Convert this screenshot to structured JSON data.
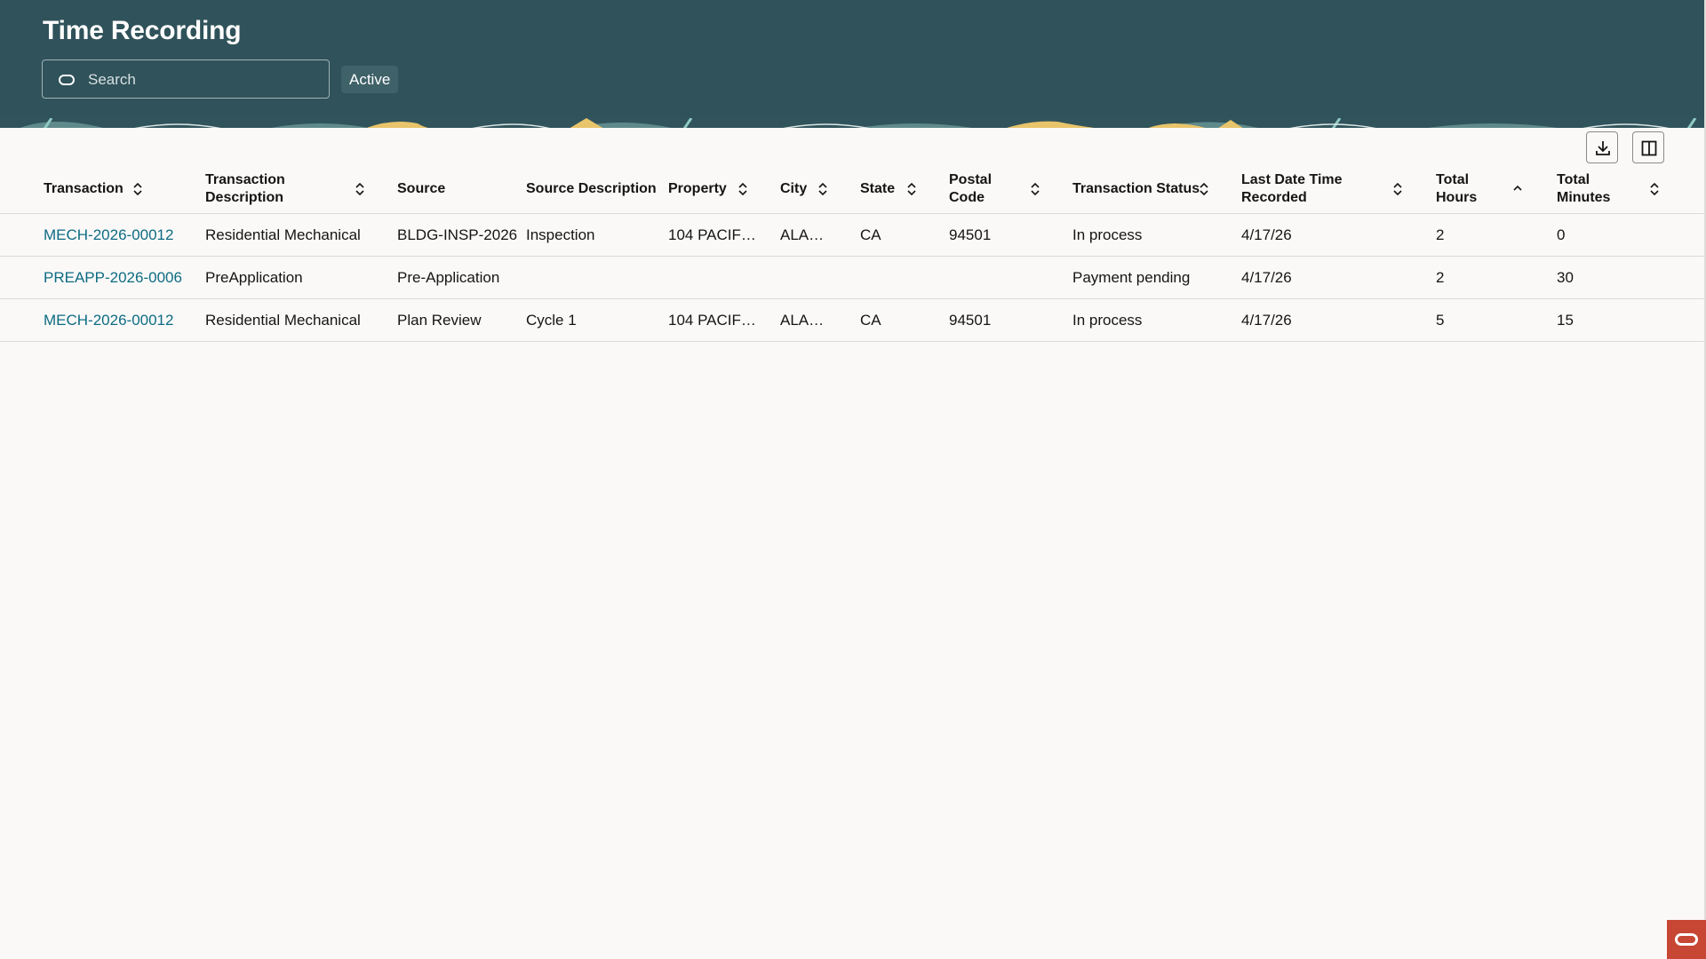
{
  "app": {
    "title": "Time Recording"
  },
  "search": {
    "placeholder": "Search"
  },
  "filter_chip": {
    "label": "Active"
  },
  "toolbar": {
    "buttons": [
      {
        "icon": "download-icon"
      },
      {
        "icon": "columns-icon"
      }
    ]
  },
  "table": {
    "columns": [
      {
        "label": "Transaction",
        "sort": "both"
      },
      {
        "label": "Transaction Description",
        "sort": "both"
      },
      {
        "label": "Source",
        "sort": "none"
      },
      {
        "label": "Source Description",
        "sort": "none"
      },
      {
        "label": "Property",
        "sort": "both"
      },
      {
        "label": "City",
        "sort": "both"
      },
      {
        "label": "State",
        "sort": "both"
      },
      {
        "label": "Postal Code",
        "sort": "both"
      },
      {
        "label": "Transaction Status",
        "sort": "both"
      },
      {
        "label": "Last Date Time Recorded",
        "sort": "both"
      },
      {
        "label": "Total Hours",
        "sort": "ascending"
      },
      {
        "label": "Total Minutes",
        "sort": "both"
      }
    ],
    "rows": [
      [
        "MECH-2026-00012",
        "Residential Mechanical",
        "BLDG-INSP-2026",
        "Inspection",
        "104 PACIF…",
        "ALA…",
        "CA",
        "94501",
        "In process",
        "4/17/26",
        "2",
        "0"
      ],
      [
        "PREAPP-2026-0006",
        "PreApplication",
        "Pre-Application",
        "",
        "",
        "",
        "",
        "",
        "Payment pending",
        "4/17/26",
        "2",
        "30"
      ],
      [
        "MECH-2026-00012",
        "Residential Mechanical",
        "Plan Review",
        "Cycle 1",
        "104 PACIF…",
        "ALA…",
        "CA",
        "94501",
        "In process",
        "4/17/26",
        "5",
        "15"
      ]
    ]
  },
  "colors": {
    "header_bg": "#30525a",
    "link": "#0d6b82",
    "page_bg": "#faf9f8",
    "brand_badge": "#c74634"
  }
}
